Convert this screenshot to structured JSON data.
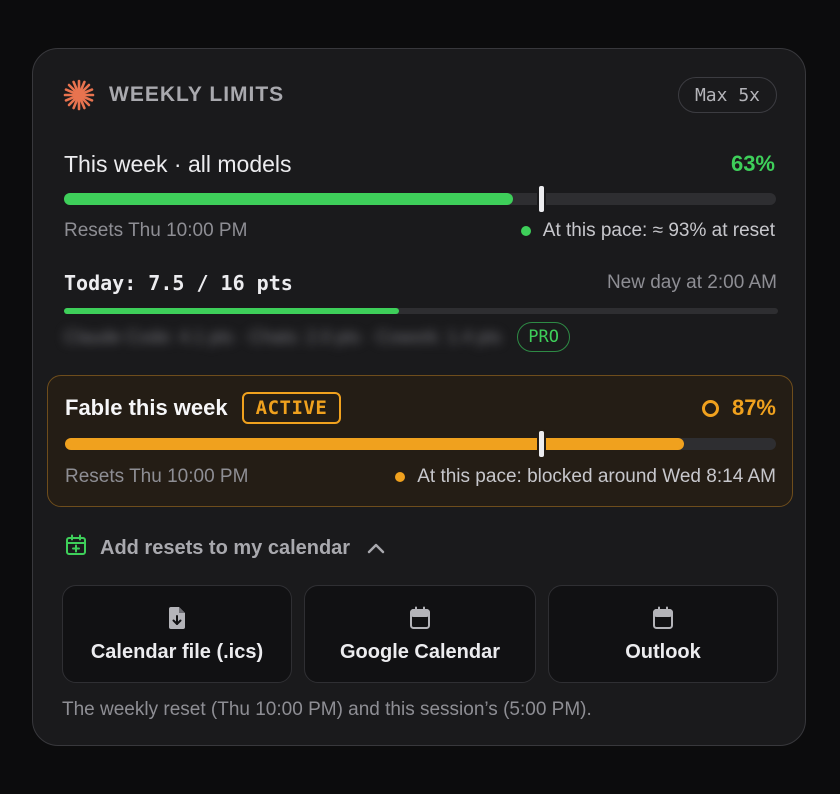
{
  "header": {
    "title": "WEEKLY LIMITS",
    "plan": "Max 5x",
    "logo_icon": "sparkle-burst-icon",
    "logo_color": "#e8734f"
  },
  "weekly": {
    "label": "This week · all models",
    "percent_text": "63%",
    "percent": 63,
    "pace_marker_percent": 67,
    "resets": "Resets Thu 10:00 PM",
    "pace": "At this pace: ≈ 93% at reset",
    "color": "#3ecf5a"
  },
  "today": {
    "label": "Today: 7.5 / 16 pts",
    "new_day": "New day at 2:00 AM",
    "progress": 0.46875,
    "breakdown_blurred": "Claude Code: 4.1 pts · Chats: 2.0 pts · Cowork: 1.4 pts",
    "badge": "PRO"
  },
  "fable": {
    "title": "Fable this week",
    "status": "ACTIVE",
    "percent_text": "87%",
    "percent": 87,
    "pace_marker_percent": 67,
    "resets": "Resets Thu 10:00 PM",
    "pace": "At this pace: blocked around Wed 8:14 AM",
    "color": "#f0a11e"
  },
  "calendar": {
    "toggle_label": "Add resets to my calendar",
    "toggle_icon": "calendar-plus-icon",
    "buttons": [
      {
        "label": "Calendar file (.ics)",
        "icon": "file-download-icon"
      },
      {
        "label": "Google Calendar",
        "icon": "calendar-icon"
      },
      {
        "label": "Outlook",
        "icon": "calendar-icon"
      }
    ],
    "footnote": "The weekly reset (Thu 10:00 PM) and this session’s (5:00 PM)."
  }
}
